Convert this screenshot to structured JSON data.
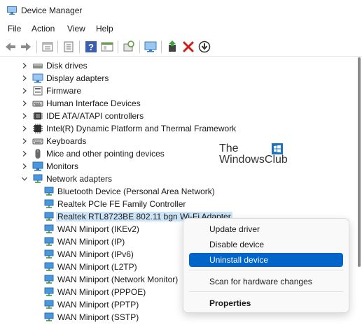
{
  "window": {
    "title": "Device Manager"
  },
  "menu": [
    "File",
    "Action",
    "View",
    "Help"
  ],
  "toolbar": {
    "buttons": [
      "back-arrow-icon",
      "forward-arrow-icon",
      "properties-icon",
      "driver-icon",
      "help-icon",
      "console-icon",
      "scan-hardware-icon",
      "monitor-icon",
      "add-driver-icon",
      "uninstall-x-icon",
      "update-down-icon"
    ],
    "uninstall_color": "#d11a1a"
  },
  "tree": {
    "categories_top": [
      {
        "label": "Disk drives",
        "icon": "disk-drive-icon"
      },
      {
        "label": "Display adapters",
        "icon": "display-adapter-icon"
      },
      {
        "label": "Firmware",
        "icon": "firmware-icon"
      },
      {
        "label": "Human Interface Devices",
        "icon": "hid-icon"
      },
      {
        "label": "IDE ATA/ATAPI controllers",
        "icon": "ide-controller-icon"
      },
      {
        "label": "Intel(R) Dynamic Platform and Thermal Framework",
        "icon": "chip-icon"
      },
      {
        "label": "Keyboards",
        "icon": "keyboard-icon"
      },
      {
        "label": "Mice and other pointing devices",
        "icon": "mouse-icon"
      },
      {
        "label": "Monitors",
        "icon": "monitor-icon"
      }
    ],
    "expanded_category": {
      "label": "Network adapters",
      "icon": "network-adapter-icon"
    },
    "network_adapters": [
      "Bluetooth Device (Personal Area Network)",
      "Realtek PCIe FE Family Controller",
      "Realtek RTL8723BE 802.11 bgn Wi-Fi Adapter",
      "WAN Miniport (IKEv2)",
      "WAN Miniport (IP)",
      "WAN Miniport (IPv6)",
      "WAN Miniport (L2TP)",
      "WAN Miniport (Network Monitor)",
      "WAN Miniport (PPPOE)",
      "WAN Miniport (PPTP)",
      "WAN Miniport (SSTP)"
    ],
    "selected_index": 2
  },
  "watermark": {
    "line1": "The",
    "line2": "WindowsClub"
  },
  "context_menu": {
    "items": [
      {
        "label": "Update driver",
        "highlighted": false,
        "bold": false
      },
      {
        "label": "Disable device",
        "highlighted": false,
        "bold": false
      },
      {
        "label": "Uninstall device",
        "highlighted": true,
        "bold": false
      },
      {
        "label": "Scan for hardware changes",
        "highlighted": false,
        "bold": false
      },
      {
        "label": "Properties",
        "highlighted": false,
        "bold": true
      }
    ],
    "highlight_color": "#0064c8"
  },
  "colors": {
    "selection": "#cce4f7",
    "icon_blue": "#2b79c2"
  }
}
